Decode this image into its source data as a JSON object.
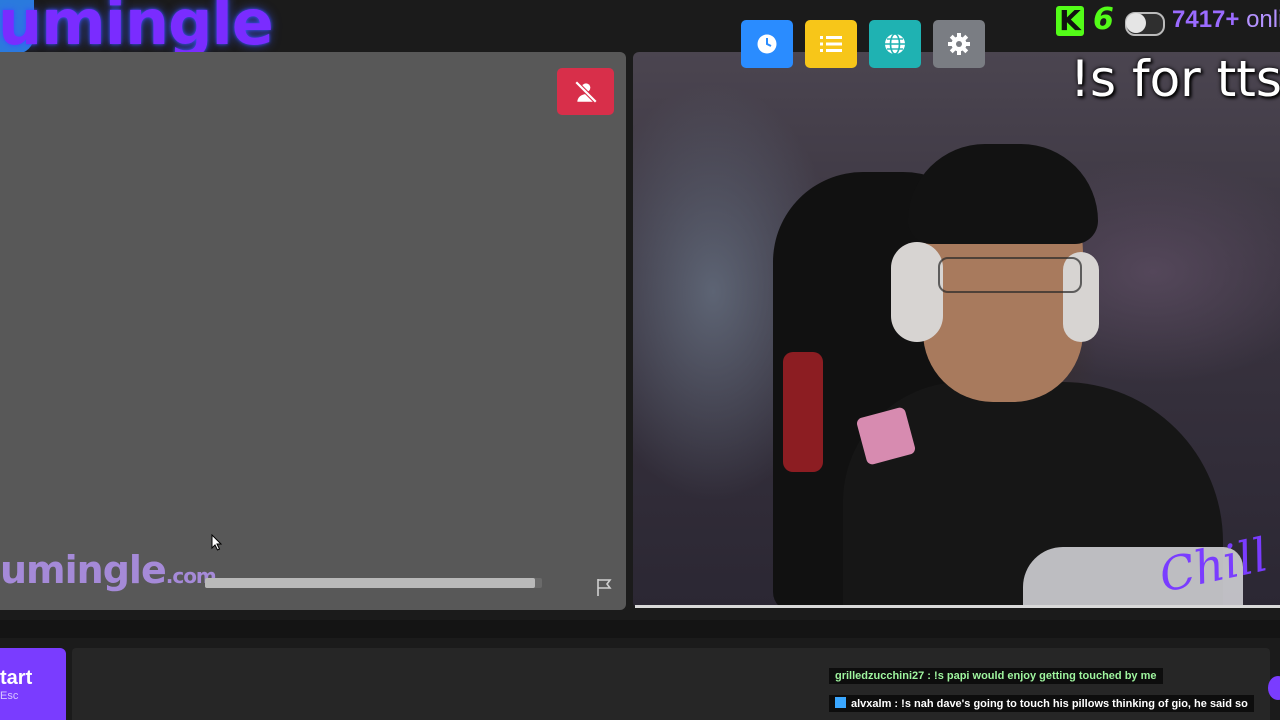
{
  "brand": {
    "logo_text": "umingle",
    "watermark_text": "umingle",
    "watermark_suffix": ".com"
  },
  "left_panel": {
    "mute_button": {
      "icon": "user-slash-icon",
      "color": "#d82f4a"
    },
    "progress": {
      "value": 0.98
    },
    "report_icon": "flag-icon"
  },
  "toolbar": {
    "buttons": [
      {
        "name": "history",
        "icon": "clock-icon",
        "color": "#2a8cff"
      },
      {
        "name": "list",
        "icon": "list-icon",
        "color": "#f7c619"
      },
      {
        "name": "globe",
        "icon": "globe-icon",
        "color": "#1fb2b2"
      },
      {
        "name": "settings",
        "icon": "gear-icon",
        "color": "#7a7d83"
      }
    ]
  },
  "stream": {
    "kick_logo": "K",
    "kick_count": "6",
    "online_count": "7417+",
    "online_label": "onli",
    "tts_text": "!s for tts",
    "overlay_text": "Chill"
  },
  "start": {
    "label": "tart",
    "key": "Esc"
  },
  "chat": [
    {
      "user": "grilledzucchini27",
      "message": "!s papi would enjoy getting touched by me"
    },
    {
      "user": "alvxalm",
      "message": "!s nah dave's going to touch his pillows thinking of gio, he said so"
    }
  ]
}
